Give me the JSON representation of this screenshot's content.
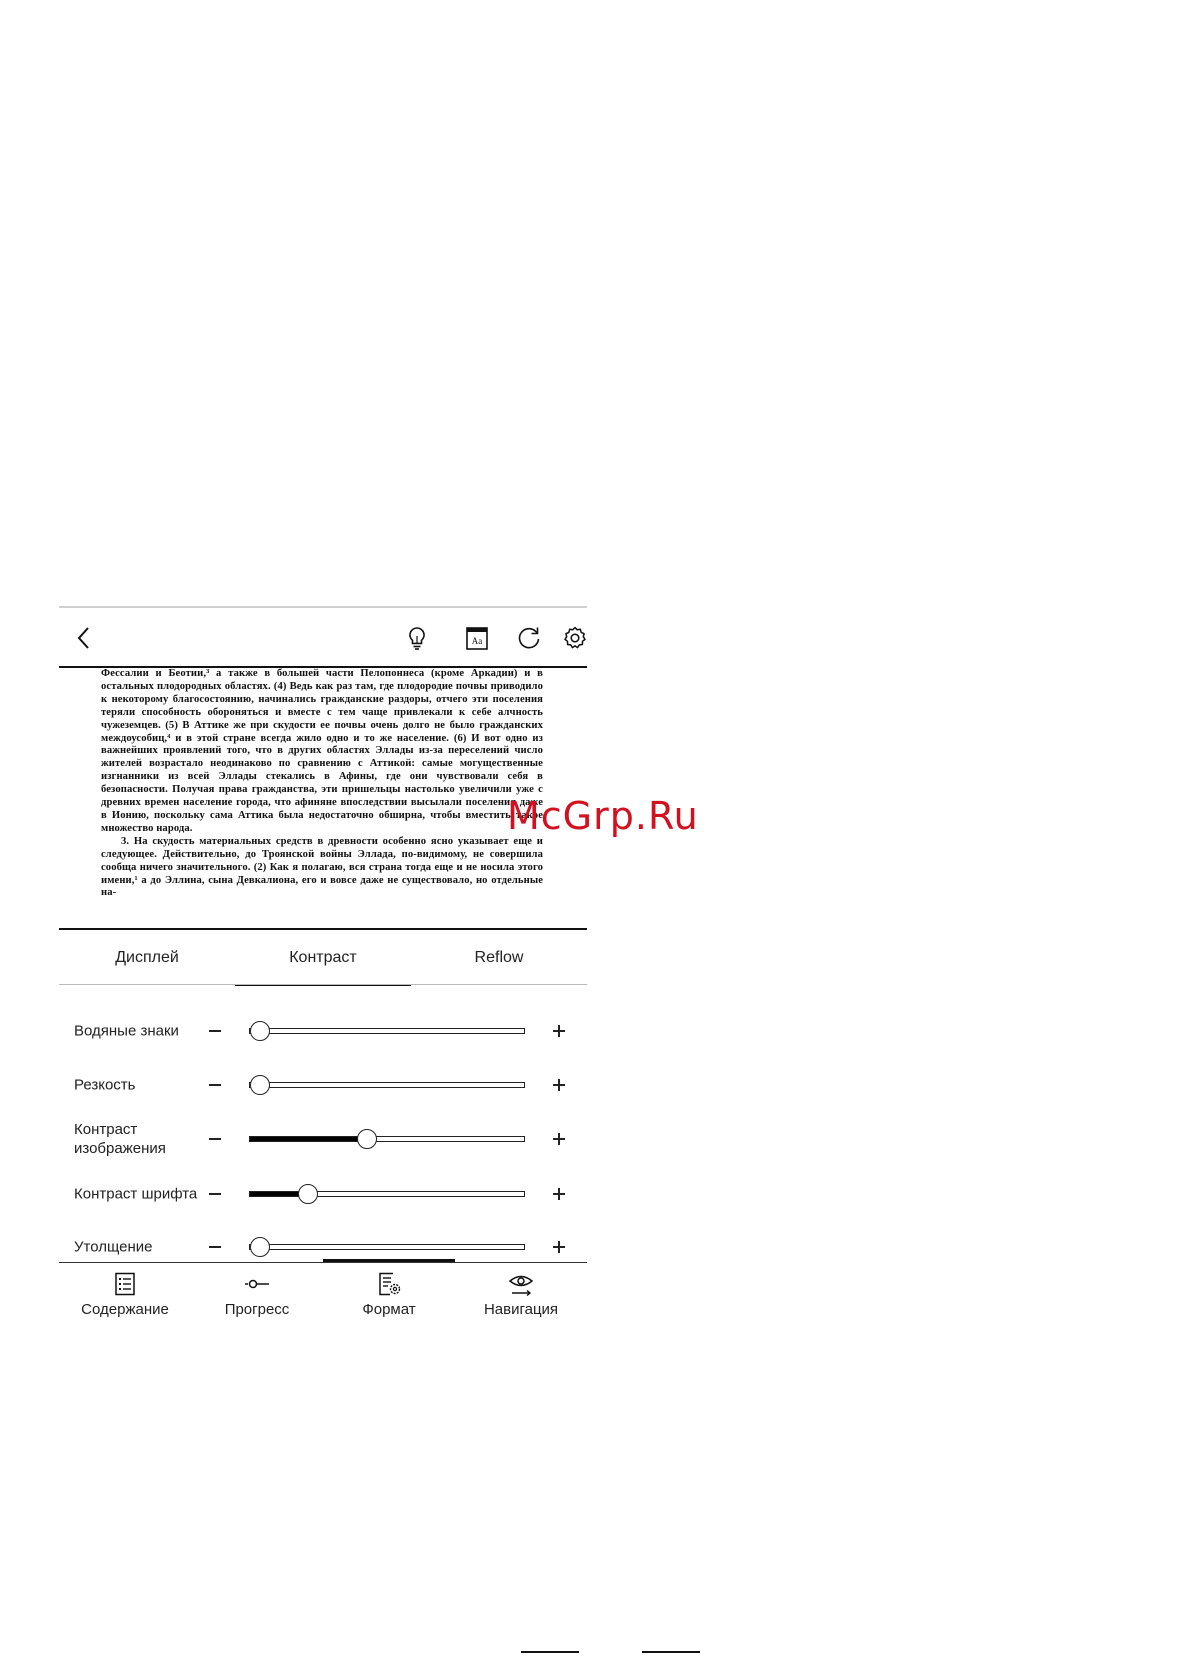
{
  "toolbar": {
    "icons": [
      "back-icon",
      "bulb-icon",
      "font-book-icon",
      "refresh-icon",
      "gear-icon"
    ],
    "font_icon_text": "Aa"
  },
  "page": {
    "paragraphs": [
      "Фессалии и Беотии,³ а также в большей части Пелопоннеса (кроме Аркадии) и в остальных плодородных областях. (4) Ведь как раз там, где плодородие почвы приводило к некоторому благосостоянию, начинались гражданские раздоры, отчего эти поселения теряли способность обороняться и вместе с тем чаще привлекали к себе алчность чужеземцев. (5) В Аттике же при скудости ее почвы очень долго не было гражданских междоусобиц,⁴ и в этой стране всегда жило одно и то же население. (6) И вот одно из важнейших проявлений того, что в других областях Эллады из-за переселений число жителей возрастало неодинаково по сравнению с Аттикой: самые могущественные изгнанники из всей Эллады стекались в Афины, где они чувствовали себя в безопасности. Получая права гражданства, эти пришельцы настолько увеличили уже с древних времен население города, что афиняне впоследствии высылали поселения даже в Ионию, поскольку сама Аттика была недостаточно обширна, чтобы вместить такое множество народа.",
      "3. На скудость материальных средств в древности особенно ясно указывает еще и следующее. Действительно, до Троянской войны Эллада, по-видимому, не совершила сообща ничего значительного. (2) Как я полагаю, вся страна тогда еще и не носила этого имени,¹ а до Эллина, сына Девкалиона, его и вовсе даже не существовало, но отдельные на-"
    ]
  },
  "tabs": [
    {
      "label": "Дисплей",
      "active": false
    },
    {
      "label": "Контраст",
      "active": true
    },
    {
      "label": "Reflow",
      "active": false
    }
  ],
  "sliders": [
    {
      "label": "Водяные знаки",
      "value": 0.0
    },
    {
      "label": "Резкость",
      "value": 0.0
    },
    {
      "label": "Контраст изображения",
      "value": 0.42
    },
    {
      "label": "Контраст шрифта",
      "value": 0.19
    },
    {
      "label": "Утолщение",
      "value": 0.0
    }
  ],
  "bottom_nav": [
    {
      "label": "Содержание",
      "icon": "list-icon",
      "active": false
    },
    {
      "label": "Прогресс",
      "icon": "progress-icon",
      "active": false
    },
    {
      "label": "Формат",
      "icon": "format-settings-icon",
      "active": true
    },
    {
      "label": "Навигация",
      "icon": "eye-icon",
      "active": false
    }
  ],
  "watermark": "McGrp.Ru",
  "colors": {
    "watermark": "#d3101f",
    "ink": "#111111",
    "background": "#ffffff"
  }
}
